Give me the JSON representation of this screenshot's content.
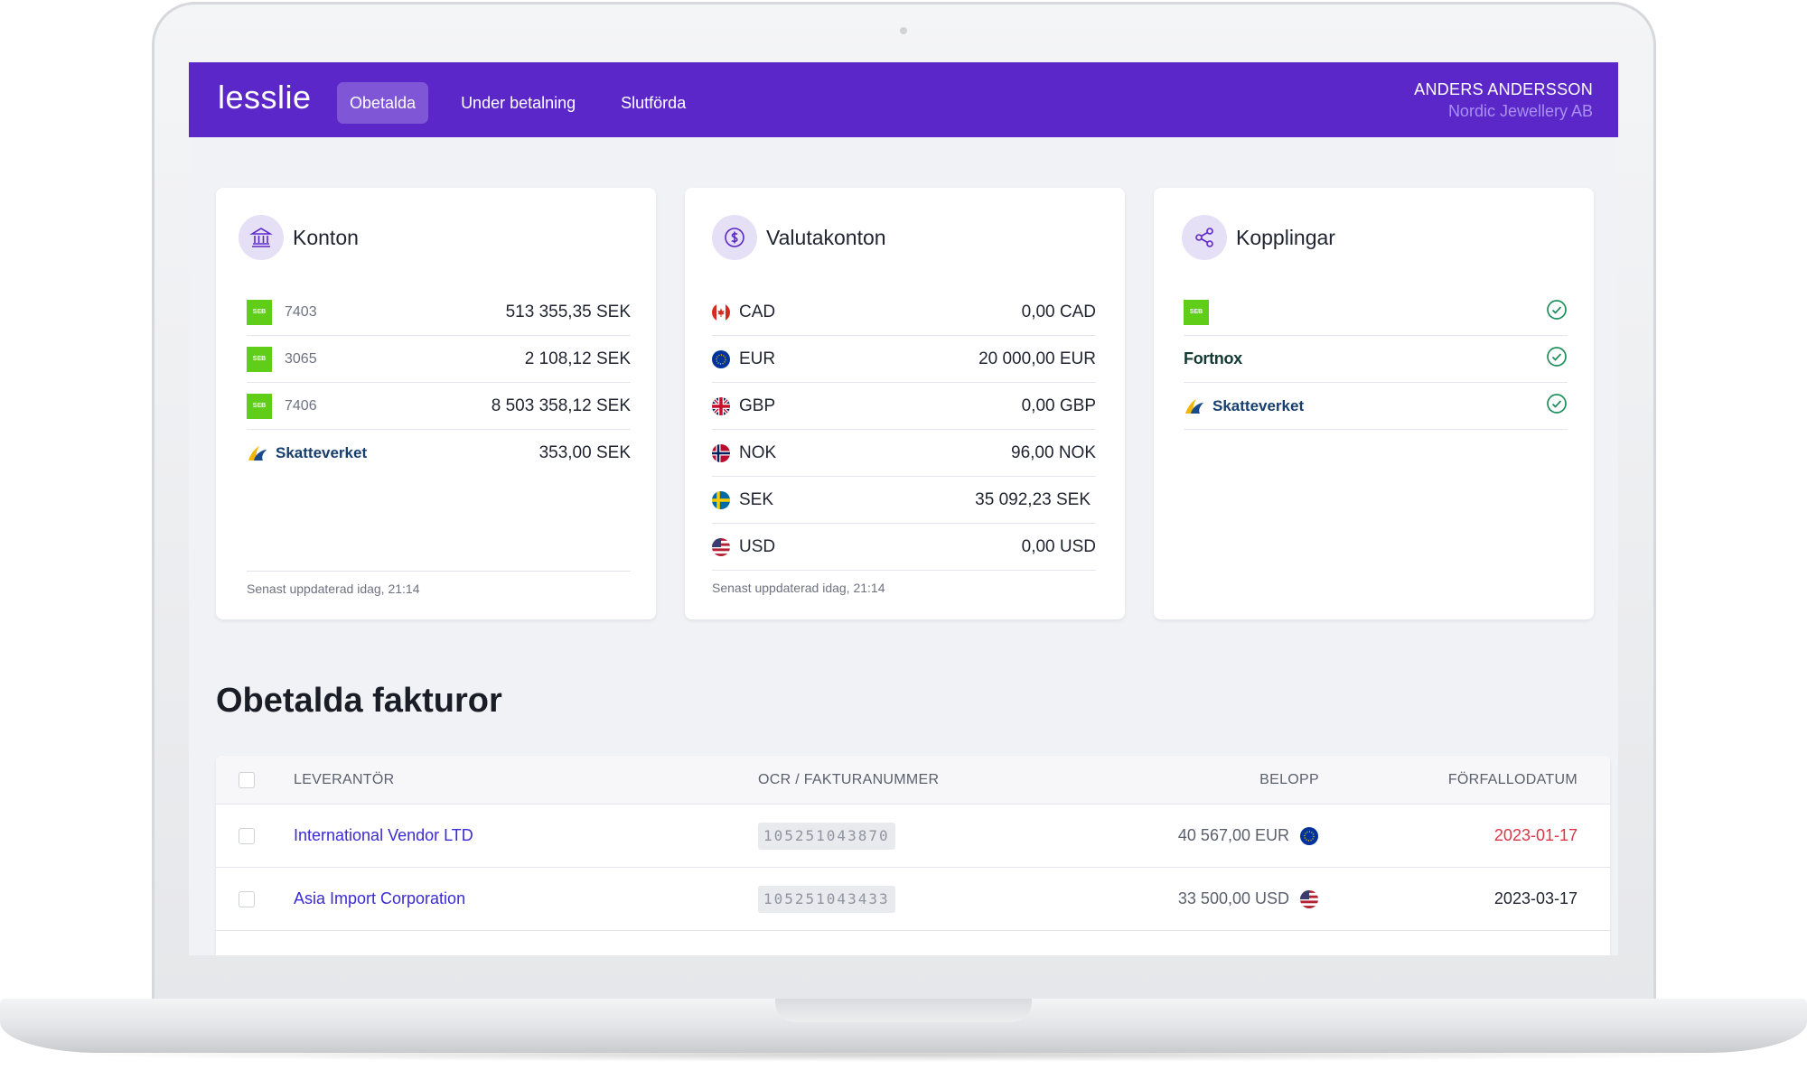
{
  "app": {
    "logo": "lesslie"
  },
  "nav": [
    {
      "label": "Obetalda",
      "active": true
    },
    {
      "label": "Under betalning",
      "active": false
    },
    {
      "label": "Slutförda",
      "active": false
    }
  ],
  "user": {
    "name": "ANDERS ANDERSSON",
    "company": "Nordic Jewellery AB"
  },
  "konton": {
    "title": "Konton",
    "icon": "bank-icon",
    "accounts": [
      {
        "bank": "SEB",
        "number": "7403",
        "amount": "513 355,35 SEK"
      },
      {
        "bank": "SEB",
        "number": "3065",
        "amount": "2 108,12 SEK"
      },
      {
        "bank": "SEB",
        "number": "7406",
        "amount": "8 503 358,12 SEK"
      },
      {
        "bank": "Skatteverket",
        "number": "",
        "amount": "353,00 SEK"
      }
    ],
    "footer": "Senast uppdaterad idag, 21:14"
  },
  "valutakonton": {
    "title": "Valutakonton",
    "icon": "dollar-icon",
    "accounts": [
      {
        "currency": "CAD",
        "amount": "0,00 CAD",
        "flag": "canada-flag-icon"
      },
      {
        "currency": "EUR",
        "amount": "20 000,00 EUR",
        "flag": "eu-flag-icon"
      },
      {
        "currency": "GBP",
        "amount": "0,00 GBP",
        "flag": "uk-flag-icon"
      },
      {
        "currency": "NOK",
        "amount": "96,00 NOK",
        "flag": "norway-flag-icon"
      },
      {
        "currency": "SEK",
        "amount": "35 092,23 SEK",
        "flag": "sweden-flag-icon"
      },
      {
        "currency": "USD",
        "amount": "0,00 USD",
        "flag": "usa-flag-icon"
      }
    ],
    "footer": "Senast uppdaterad idag, 21:14"
  },
  "kopplingar": {
    "title": "Kopplingar",
    "icon": "share-icon",
    "connections": [
      {
        "name": "SEB",
        "status": "connected"
      },
      {
        "name": "Fortnox",
        "status": "connected"
      },
      {
        "name": "Skatteverket",
        "status": "connected"
      }
    ]
  },
  "invoices": {
    "title": "Obetalda fakturor",
    "columns": {
      "vendor": "LEVERANTÖR",
      "ocr": "OCR / FAKTURANUMMER",
      "amount": "BELOPP",
      "due": "FÖRFALLODATUM"
    },
    "rows": [
      {
        "vendor": "International Vendor LTD",
        "ocr": "105251043870",
        "amount": "40 567,00 EUR",
        "currency_flag": "eu-flag-icon",
        "due": "2023-01-17",
        "overdue": true
      },
      {
        "vendor": "Asia Import Corporation",
        "ocr": "105251043433",
        "amount": "33 500,00 USD",
        "currency_flag": "usa-flag-icon",
        "due": "2023-03-17",
        "overdue": false
      }
    ]
  },
  "colors": {
    "brand": "#5c27c9",
    "link": "#3b2bd6",
    "overdue": "#dc3545",
    "seb": "#60cd18",
    "success": "#1d8f5a"
  }
}
